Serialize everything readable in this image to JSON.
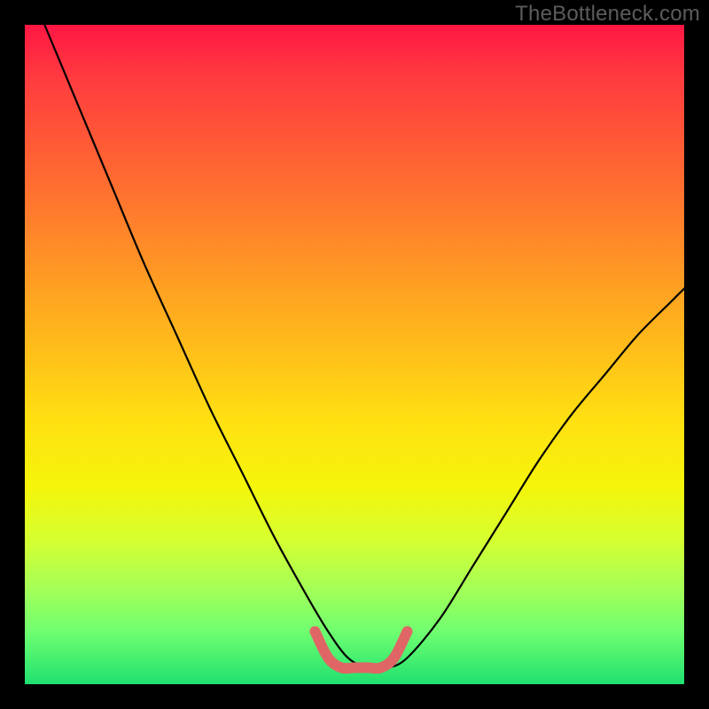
{
  "watermark": "TheBottleneck.com",
  "chart_data": {
    "type": "line",
    "title": "",
    "xlabel": "",
    "ylabel": "",
    "xlim": [
      0,
      100
    ],
    "ylim": [
      0,
      100
    ],
    "grid": false,
    "legend": false,
    "series": [
      {
        "name": "bottleneck-curve",
        "color": "#000000",
        "x": [
          3,
          8,
          13,
          18,
          23,
          28,
          33,
          38,
          43,
          46,
          49,
          52,
          55,
          58,
          63,
          68,
          73,
          78,
          83,
          88,
          93,
          98,
          100
        ],
        "y": [
          100,
          88,
          76,
          64,
          53,
          42,
          32,
          22,
          13,
          8,
          4,
          2.5,
          2.5,
          4,
          10,
          18,
          26,
          34,
          41,
          47,
          53,
          58,
          60
        ]
      },
      {
        "name": "optimal-region",
        "color": "#e06666",
        "x": [
          44,
          46,
          48,
          50,
          52,
          54,
          56,
          58
        ],
        "y": [
          8,
          4,
          2.5,
          2.5,
          2.5,
          2.5,
          4,
          8
        ]
      }
    ],
    "annotations": []
  }
}
